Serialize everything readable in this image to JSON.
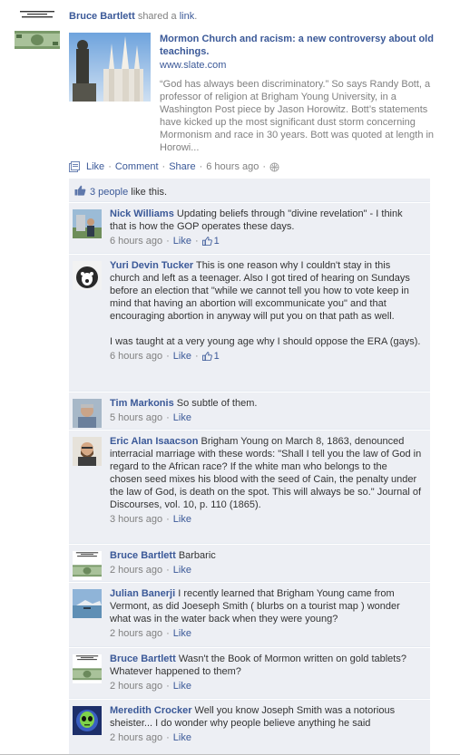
{
  "story": {
    "author": "Bruce Bartlett",
    "shared_text": "shared a",
    "link_word": "link",
    "period": "."
  },
  "attachment": {
    "title": "Mormon Church and racism: a new controversy about old teachings.",
    "source": "www.slate.com",
    "description": "“God has always been discriminatory.” So says Randy Bott, a professor of religion at Brigham Young University, in a Washington Post piece by Jason Horowitz. Bott’s statements have kicked up the most significant dust storm concerning Mormonism and race in 30 years. Bott was quoted at length in Horowi..."
  },
  "actions": {
    "like": "Like",
    "comment": "Comment",
    "share": "Share",
    "time": "6 hours ago",
    "dot": "·",
    "privacy_icon": "globe-icon"
  },
  "likes": {
    "count_text": "3 people",
    "suffix": "like this."
  },
  "comments": [
    {
      "author": "Nick Williams",
      "text": "Updating beliefs through \"divine revelation\" - I think that is how the GOP operates these days.",
      "time": "6 hours ago",
      "like": "Like",
      "likes": "1",
      "avatar": "avatar-photo-nick"
    },
    {
      "author": "Yuri Devin Tucker",
      "text": "This is one reason why I couldn't stay in this church and left as a teenager. Also I got tired of hearing on Sundays before an election that \"while we cannot tell you how to vote keep in mind that having an abortion will excommunicate you\" and that encouraging abortion in anyway will put you on that path as well.",
      "text2": "I was taught at a very young age why I should oppose the ERA (gays).",
      "time": "6 hours ago",
      "like": "Like",
      "likes": "1",
      "avatar": "avatar-photo-yuri"
    },
    {
      "author": "Tim Markonis",
      "text": "So subtle of them.",
      "time": "5 hours ago",
      "like": "Like",
      "avatar": "avatar-photo-tim"
    },
    {
      "author": "Eric Alan Isaacson",
      "text": "Brigham Young on March 8, 1863, denounced interracial marriage with these words: \"Shall I tell you the law of God in regard to the African race? If the white man who belongs to the chosen seed mixes his blood with the seed of Cain, the penalty under the law of God, is death on the spot. This will always be so.\" Journal of Discourses, vol. 10, p. 110 (1865).",
      "time": "3 hours ago",
      "like": "Like",
      "avatar": "avatar-photo-eric"
    },
    {
      "author": "Bruce Bartlett",
      "text": "Barbaric",
      "time": "2 hours ago",
      "like": "Like",
      "avatar": "avatar-book-cover"
    },
    {
      "author": "Julian Banerji",
      "text": "I recently learned that Brigham Young came from Vermont, as did Joeseph Smith ( blurbs on a tourist map ) wonder what was in the water back when they were young?",
      "time": "2 hours ago",
      "like": "Like",
      "avatar": "avatar-photo-julian"
    },
    {
      "author": "Bruce Bartlett",
      "text": "Wasn't the Book of Mormon written on gold tablets? Whatever happened to them?",
      "time": "2 hours ago",
      "like": "Like",
      "avatar": "avatar-book-cover"
    },
    {
      "author": "Meredith Crocker",
      "text": "Well you know Joseph Smith was a notorious sheister... I do wonder why people believe anything he said",
      "time": "2 hours ago",
      "like": "Like",
      "avatar": "avatar-photo-meredith"
    }
  ],
  "colors": {
    "link": "#3b5998",
    "meta": "#808080",
    "ufi_bg": "#edeff4"
  }
}
